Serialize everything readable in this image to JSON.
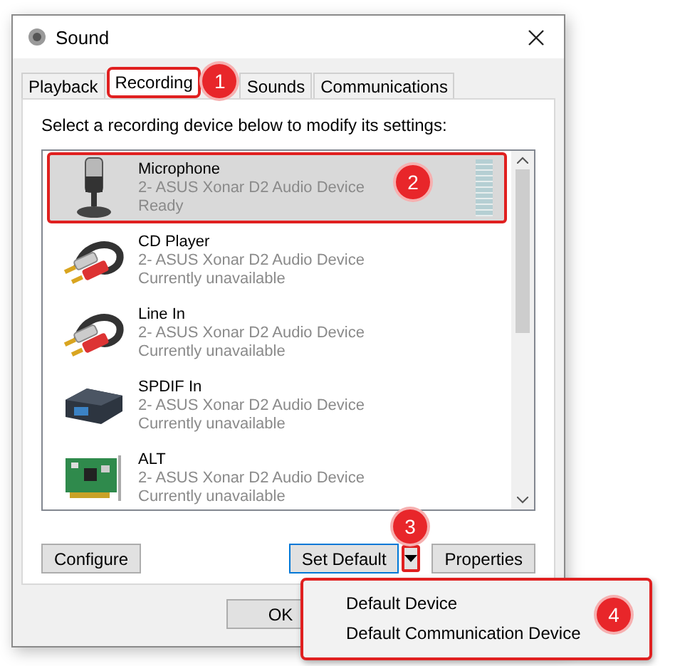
{
  "window": {
    "title": "Sound"
  },
  "tabs": [
    {
      "label": "Playback",
      "selected": false,
      "highlighted": false
    },
    {
      "label": "Recording",
      "selected": true,
      "highlighted": true
    },
    {
      "label": "Sounds",
      "selected": false,
      "highlighted": false
    },
    {
      "label": "Communications",
      "selected": false,
      "highlighted": false
    }
  ],
  "instruction": "Select a recording device below to modify its settings:",
  "devices": [
    {
      "kind": "microphone",
      "name": "Microphone",
      "driver": "2- ASUS Xonar D2 Audio Device",
      "status": "Ready",
      "selected": true,
      "highlighted": true,
      "level": 0
    },
    {
      "kind": "rca",
      "name": "CD Player",
      "driver": "2- ASUS Xonar D2 Audio Device",
      "status": "Currently unavailable",
      "selected": false,
      "highlighted": false
    },
    {
      "kind": "rca",
      "name": "Line In",
      "driver": "2- ASUS Xonar D2 Audio Device",
      "status": "Currently unavailable",
      "selected": false,
      "highlighted": false
    },
    {
      "kind": "spdif",
      "name": "SPDIF In",
      "driver": "2- ASUS Xonar D2 Audio Device",
      "status": "Currently unavailable",
      "selected": false,
      "highlighted": false
    },
    {
      "kind": "card",
      "name": "ALT",
      "driver": "2- ASUS Xonar D2 Audio Device",
      "status": "Currently unavailable",
      "selected": false,
      "highlighted": false
    }
  ],
  "buttons": {
    "configure": "Configure",
    "set_default": "Set Default",
    "dropdown_arrow_highlighted": true,
    "properties": "Properties",
    "ok": "OK"
  },
  "dropdown_menu": {
    "highlighted": true,
    "items": [
      "Default Device",
      "Default Communication Device"
    ]
  },
  "callouts": [
    "1",
    "2",
    "3",
    "4"
  ]
}
